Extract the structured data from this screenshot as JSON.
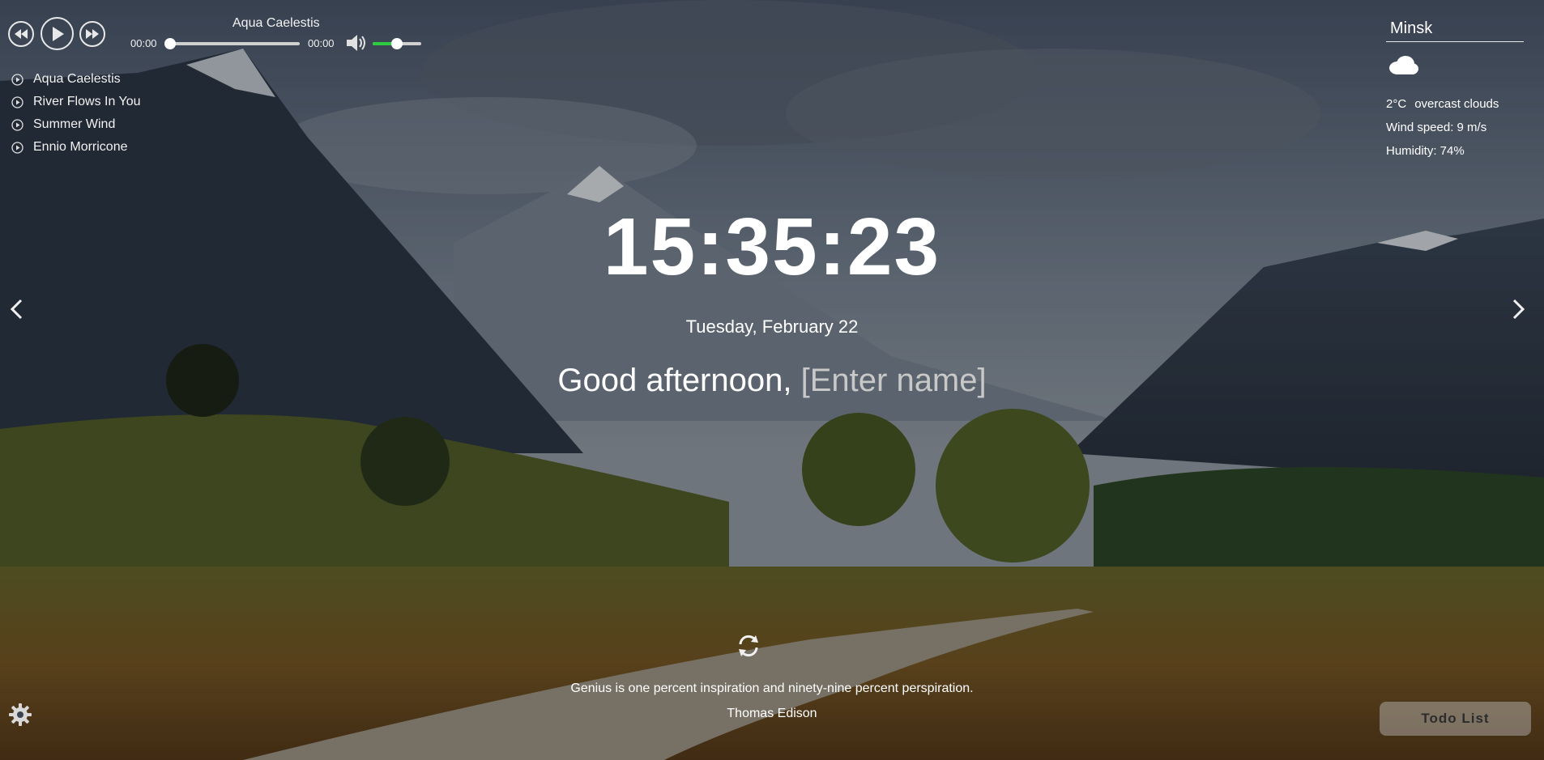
{
  "player": {
    "current_track": "Aqua Caelestis",
    "current_time": "00:00",
    "duration": "00:00",
    "progress_fraction": 0.0,
    "volume_fraction": 0.5,
    "volume_color": "#2ecc40",
    "icons": {
      "prev": "rewind-icon",
      "play": "play-icon",
      "next": "fast-forward-icon",
      "volume": "speaker-icon"
    }
  },
  "playlist": [
    {
      "label": "Aqua Caelestis"
    },
    {
      "label": "River Flows In You"
    },
    {
      "label": "Summer Wind"
    },
    {
      "label": "Ennio Morricone"
    }
  ],
  "weather": {
    "city": "Minsk",
    "icon": "cloud-icon",
    "temperature": "2°C",
    "description": "overcast clouds",
    "wind": "Wind speed: 9 m/s",
    "humidity": "Humidity: 74%"
  },
  "clock": {
    "time": "15:35:23",
    "date": "Tuesday, February 22"
  },
  "greeting": {
    "text": "Good afternoon,",
    "name_placeholder": "[Enter name]"
  },
  "quote": {
    "text": "Genius is one percent inspiration and ninety-nine percent perspiration.",
    "author": "Thomas Edison",
    "refresh_icon": "refresh-icon"
  },
  "controls": {
    "settings_icon": "gear-icon",
    "todo_label": "Todo List",
    "prev_slide_icon": "chevron-left-icon",
    "next_slide_icon": "chevron-right-icon"
  }
}
